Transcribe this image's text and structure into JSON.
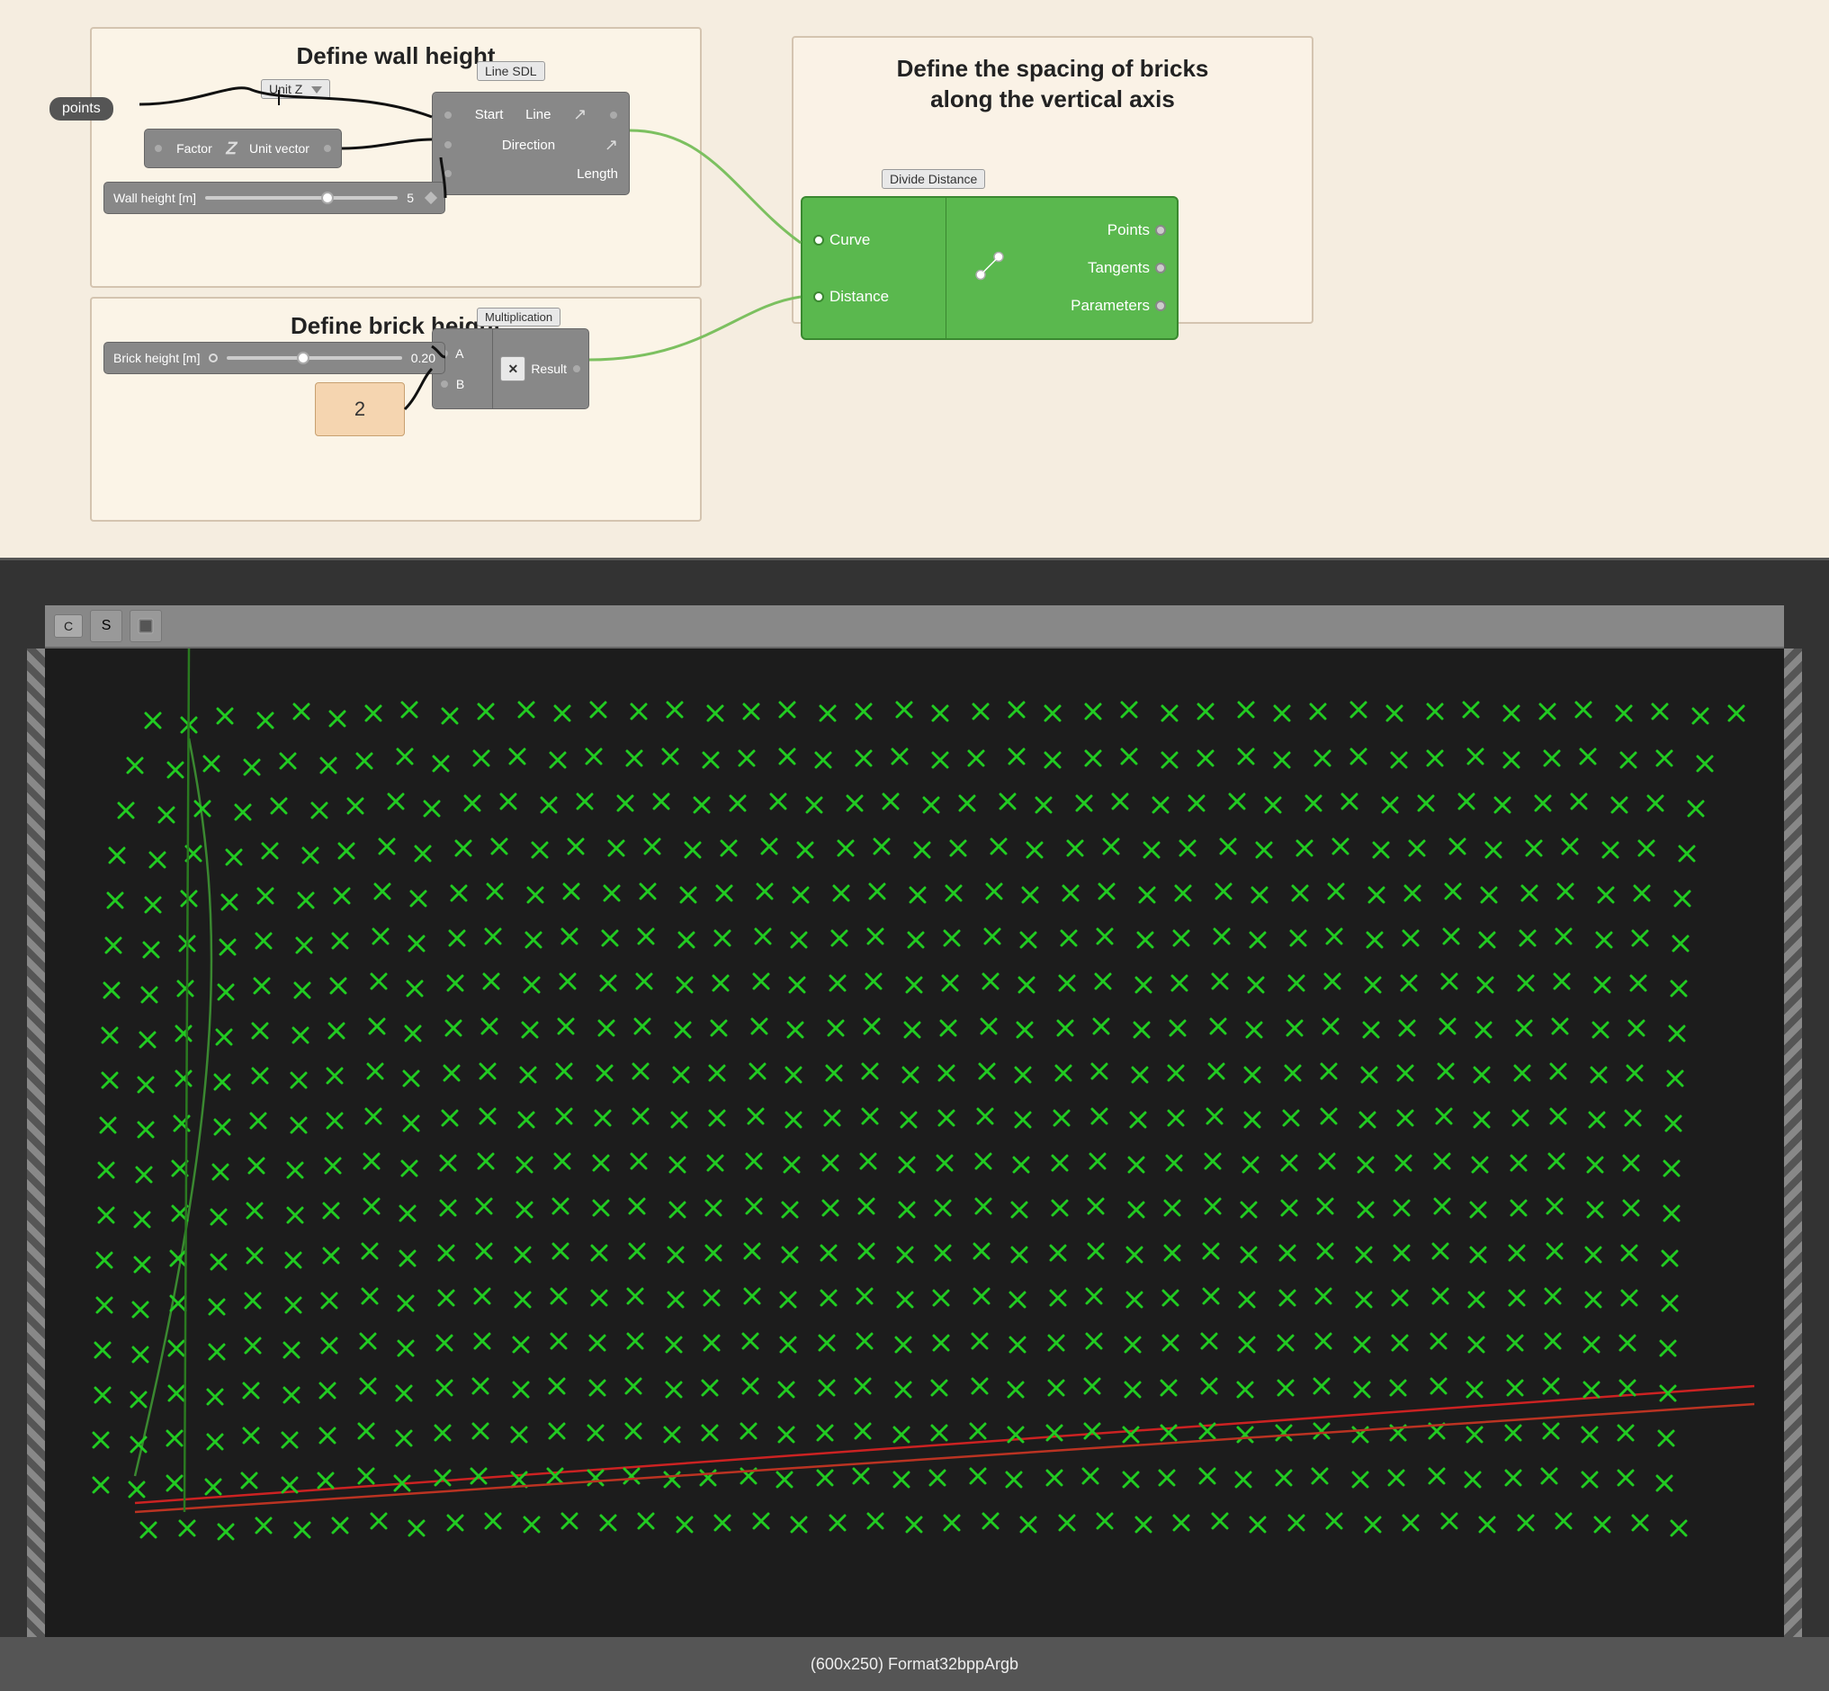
{
  "wall_height_box": {
    "title": "Define wall height"
  },
  "brick_height_box": {
    "title": "Define brick height"
  },
  "spacing_box": {
    "title": "Define the spacing of bricks\nalong the vertical axis"
  },
  "nodes": {
    "points_pill": "points",
    "unit_z": "Unit Z",
    "line_sdl": "Line SDL",
    "line_sdl_ports": {
      "start": "Start",
      "direction": "Direction",
      "length": "Length",
      "line": "Line"
    },
    "factor_unit_vector": {
      "left": "Factor",
      "icon": "↗",
      "right": "Unit vector"
    },
    "wall_height_slider": {
      "label": "Wall height [m]",
      "value": "5"
    },
    "multiplication": "Multiplication",
    "mult_ports": {
      "a": "A",
      "b": "B",
      "result": "Result"
    },
    "brick_height_slider": {
      "label": "Brick height [m]",
      "value": "0.20"
    },
    "num2": "2",
    "divide_distance": "Divide Distance",
    "divide_ports": {
      "curve": "Curve",
      "distance": "Distance",
      "points": "Points",
      "tangents": "Tangents",
      "parameters": "Parameters"
    }
  },
  "viewport": {
    "toolbar_btn_c": "C",
    "toolbar_btn_s": "S",
    "status_text": "(600x250) Format32bppArgb"
  }
}
